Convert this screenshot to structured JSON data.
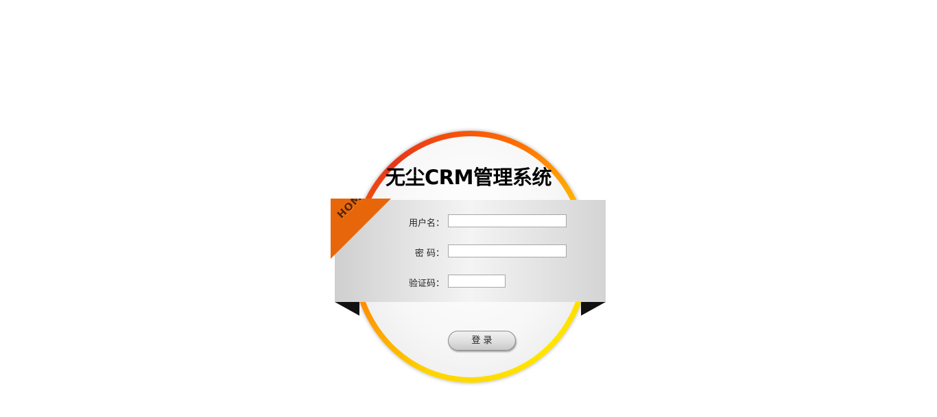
{
  "title": "无尘CRM管理系统",
  "ribbon": {
    "label": "HOME"
  },
  "form": {
    "username_label": "用户名：",
    "username_value": "",
    "password_label": "密 码：",
    "password_value": "",
    "captcha_label": "验证码：",
    "captcha_value": ""
  },
  "login_button": {
    "label": "登 录"
  },
  "colors": {
    "ring_orange": "#ff6a00",
    "ring_yellow": "#ffd400",
    "ribbon": "#e8660a",
    "band": "#e0e0e0"
  }
}
